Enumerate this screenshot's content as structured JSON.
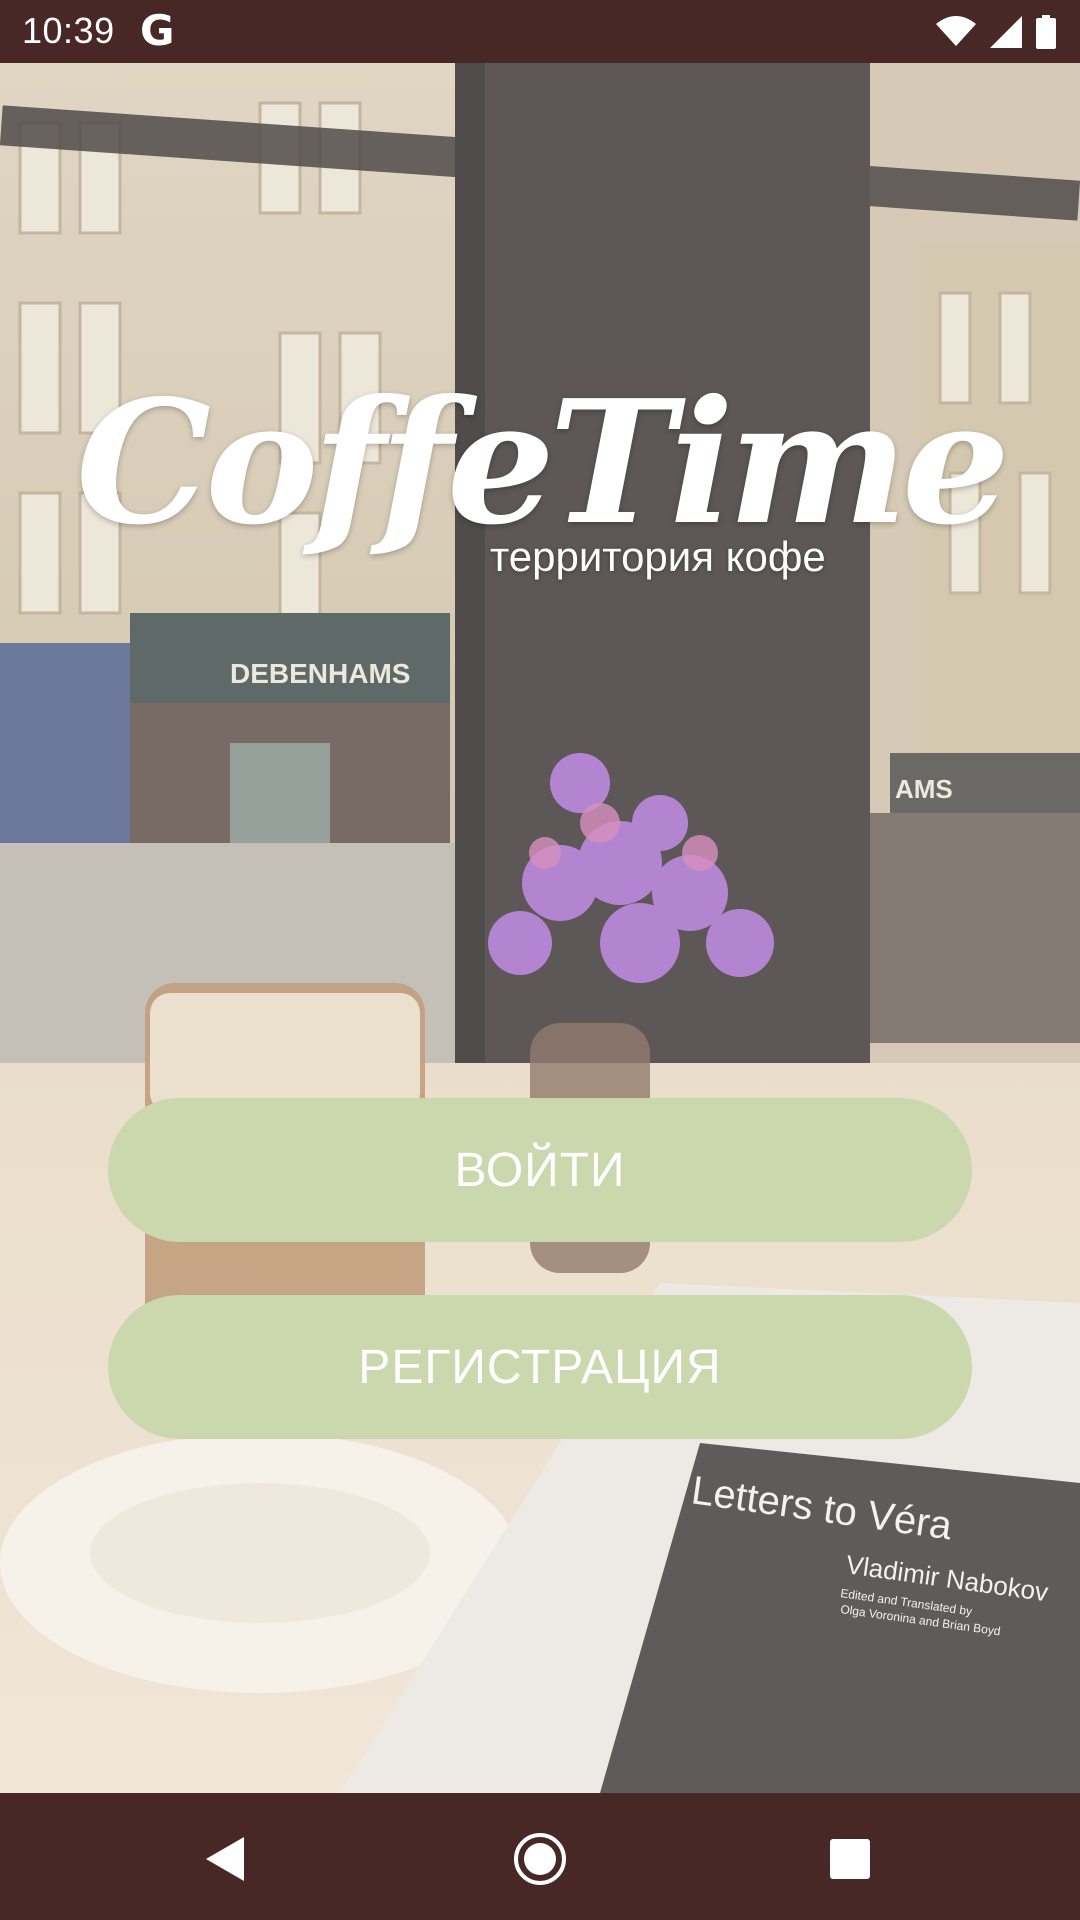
{
  "status_bar": {
    "time": "10:39",
    "google_icon": "google-g-icon",
    "wifi_icon": "wifi-icon",
    "signal_icon": "cell-signal-icon",
    "battery_icon": "battery-icon"
  },
  "logo": {
    "title": "CoffeTime",
    "subtitle": "территория кофе"
  },
  "buttons": {
    "login_label": "ВОЙТИ",
    "register_label": "РЕГИСТРАЦИЯ"
  },
  "background": {
    "storefront_sign": "DEBENHAMS",
    "storefront_sign_partial": "AMS",
    "book_title": "Letters to Véra",
    "book_author": "Vladimir Nabokov",
    "book_credit_line1": "Edited and Translated by",
    "book_credit_line2": "Olga Voronina and Brian Boyd"
  },
  "nav_bar": {
    "back_icon": "back-triangle-icon",
    "home_icon": "home-circle-icon",
    "recents_icon": "recents-square-icon"
  },
  "colors": {
    "status_bar": "#482826",
    "nav_bar": "#482826",
    "button_bg": "#cbd8ad",
    "button_text": "#ffffff"
  }
}
